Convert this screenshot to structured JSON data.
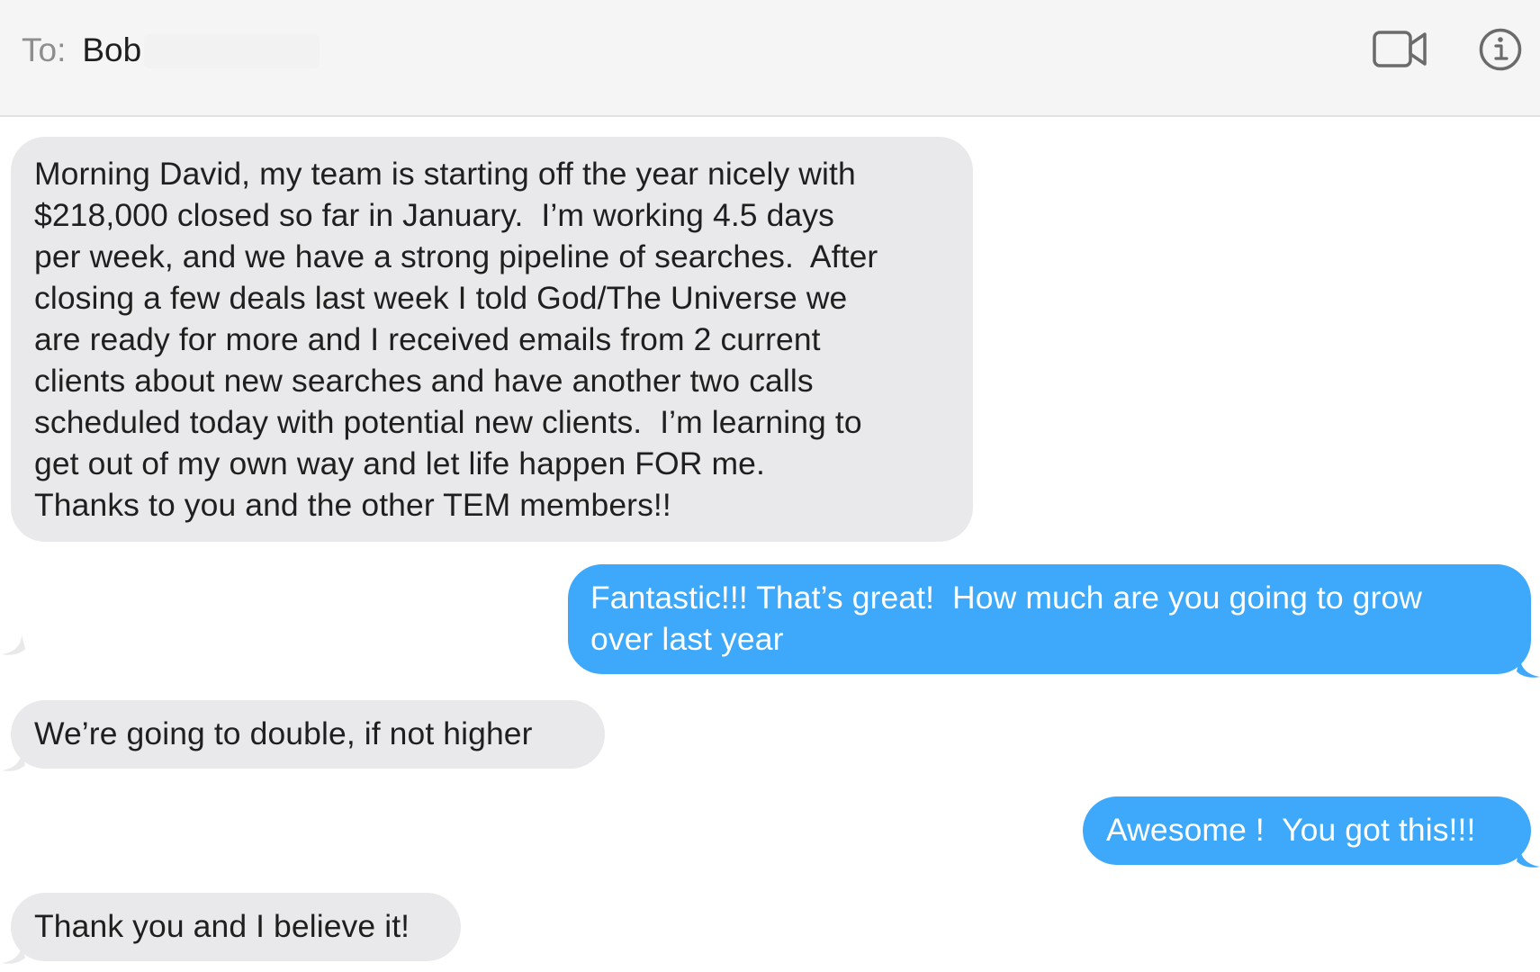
{
  "header": {
    "to_label": "To:",
    "recipient": "Bob",
    "icons": [
      "video-call-icon",
      "info-icon"
    ]
  },
  "messages": [
    {
      "direction": "received",
      "text": "Morning David, my team is starting off the year nicely with\n$218,000 closed so far in January.  I’m working 4.5 days\nper week, and we have a strong pipeline of searches.  After\nclosing a few deals last week I told God/The Universe we\nare ready for more and I received emails from 2 current\nclients about new searches and have another two calls\nscheduled today with potential new clients.  I’m learning to\nget out of my own way and let life happen FOR me.\nThanks to you and the other TEM members!!"
    },
    {
      "direction": "sent",
      "text": "Fantastic!!! That’s great!  How much are you going to grow\nover last year"
    },
    {
      "direction": "received",
      "text": "We’re going to double, if not higher"
    },
    {
      "direction": "sent",
      "text": "Awesome !  You got this!!!"
    },
    {
      "direction": "received",
      "text": "Thank you and I believe it!"
    }
  ],
  "colors": {
    "header_bg": "#f5f5f5",
    "received_bubble": "#e9e9eb",
    "sent_bubble": "#3ea8fa",
    "sent_text": "#ffffff",
    "received_text": "#1f1f1f",
    "label_gray": "#8e8e8e"
  }
}
